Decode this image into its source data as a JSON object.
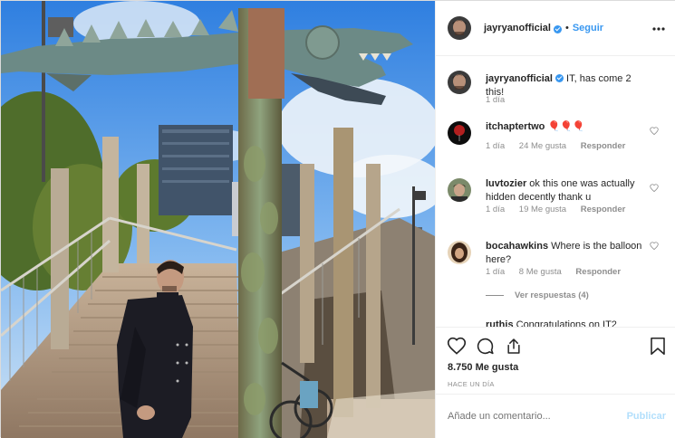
{
  "post": {
    "author": "jayryanofficial",
    "follow_label": "Seguir",
    "separator": "•",
    "more_icon": "more-horizontal-icon"
  },
  "comments": [
    {
      "user": "jayryanofficial",
      "text": "IT, has come 2 this!",
      "time": "1 día",
      "likes": "",
      "verified": true
    },
    {
      "user": "itchaptertwo",
      "text": "🎈🎈🎈",
      "time": "1 día",
      "likes": "24 Me gusta",
      "reply": "Responder"
    },
    {
      "user": "luvtozier",
      "text": "ok this one was actually hidden decently thank u",
      "time": "1 día",
      "likes": "19 Me gusta",
      "reply": "Responder"
    },
    {
      "user": "bocahawkins",
      "text": "Where is the balloon here?",
      "time": "1 día",
      "likes": "8 Me gusta",
      "reply": "Responder"
    },
    {
      "user": "ruthis",
      "text": "Congratulations on IT2",
      "time": "",
      "likes": ""
    }
  ],
  "view_replies": "Ver respuestas (4)",
  "actions": {
    "like_icon": "heart-icon",
    "comment_icon": "comment-icon",
    "share_icon": "share-icon",
    "save_icon": "bookmark-icon"
  },
  "likes_count": "8.750 Me gusta",
  "time_ago": "HACE UN DÍA",
  "add_comment": {
    "placeholder": "Añade un comentario...",
    "publish_label": "Publicar"
  },
  "colors": {
    "link_blue": "#3897f0",
    "muted": "#8e8e8e",
    "publish_disabled": "#b2dffc"
  }
}
